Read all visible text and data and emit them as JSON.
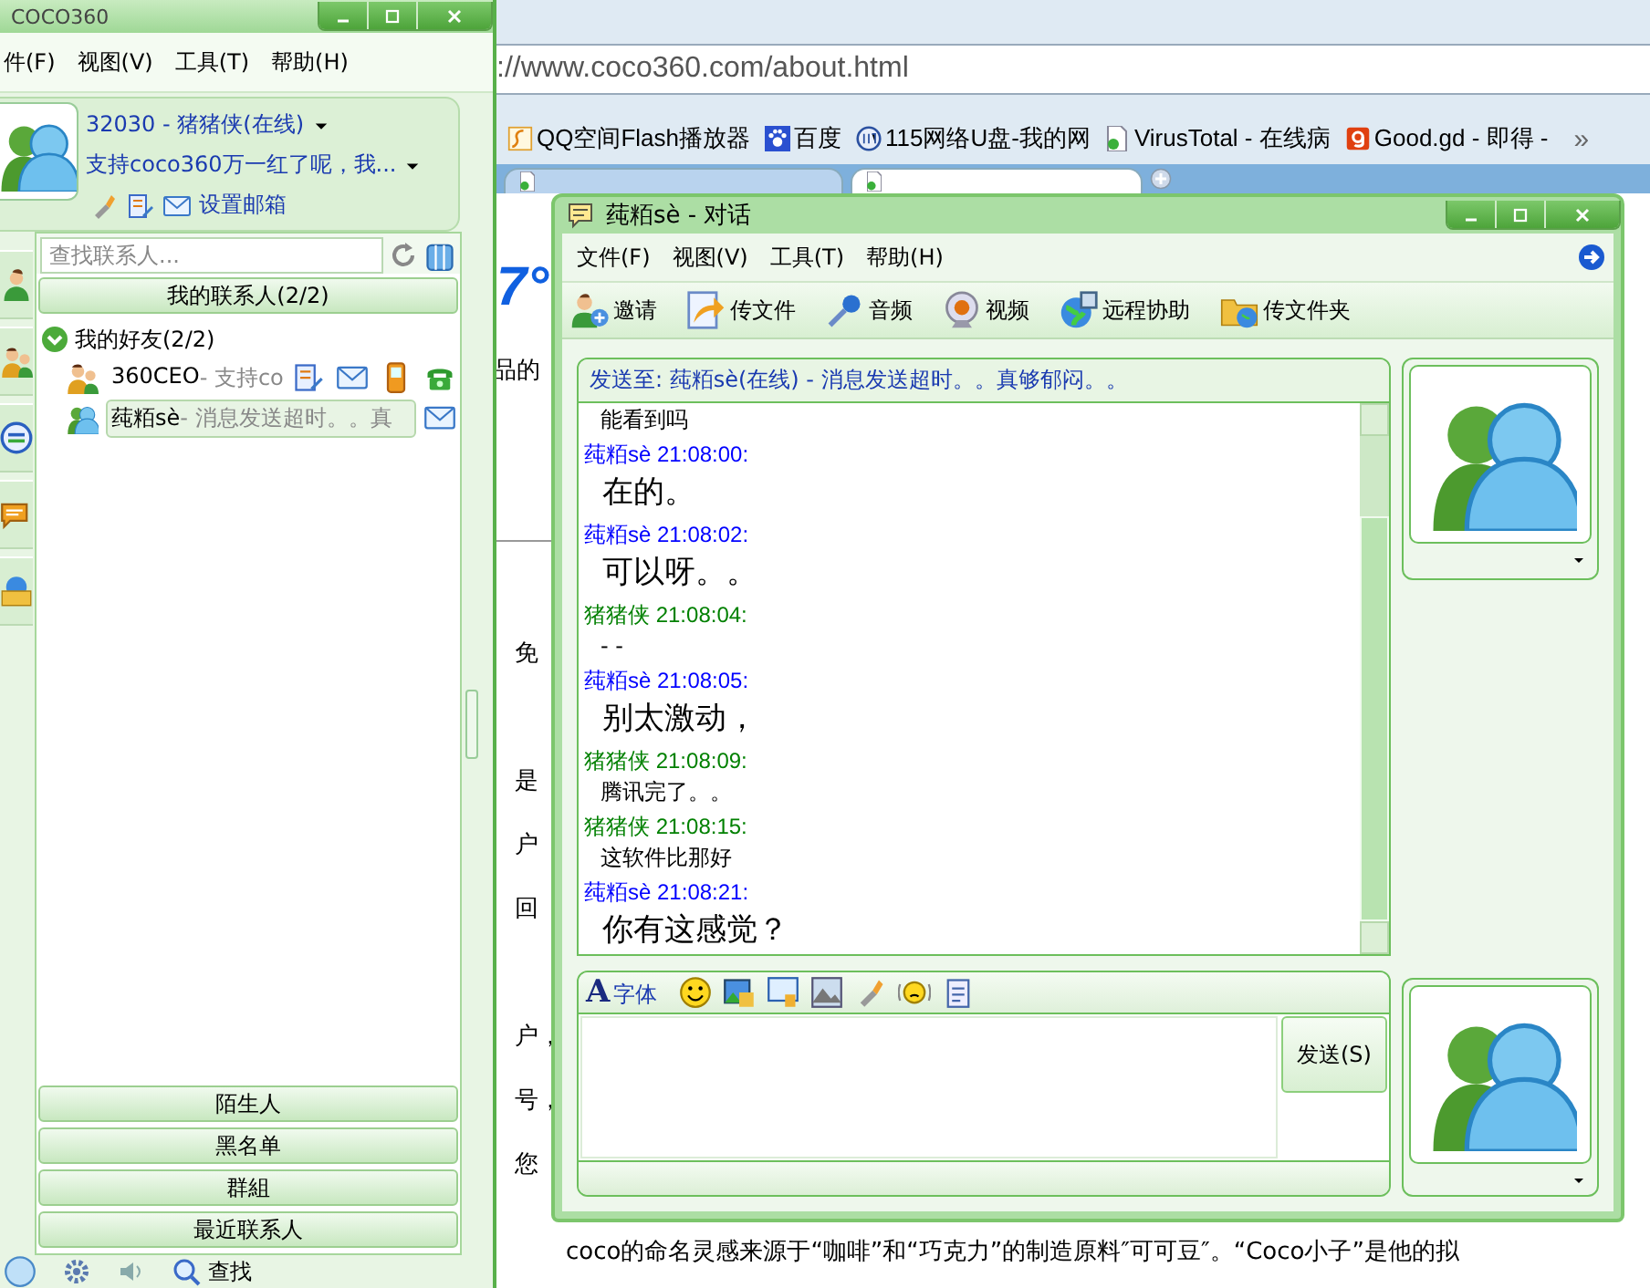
{
  "browser": {
    "address": "://www.coco360.com/about.html",
    "bookmarks": [
      {
        "label": "QQ空间Flash播放器",
        "kind": "flash"
      },
      {
        "label": "百度",
        "kind": "paw"
      },
      {
        "label": "115网络U盘-我的网",
        "kind": "disk"
      },
      {
        "label": "VirusTotal - 在线病",
        "kind": "page"
      },
      {
        "label": "Good.gd - 即得 -",
        "kind": "good"
      }
    ],
    "more": "»",
    "tabs": [
      {
        "selected": false
      },
      {
        "selected": true
      }
    ],
    "page": {
      "heading": "7°",
      "fragment": "品的",
      "lines": [
        "免",
        "是",
        "户",
        "回",
        "户，",
        "号，",
        "您"
      ],
      "footer": "coco的命名灵感来源于“咖啡”和“巧克力”的制造原料″可可豆″。“Coco小子”是他的拟"
    }
  },
  "contact_window": {
    "title": "COCO360",
    "menu": [
      "件(F)",
      "视图(V)",
      "工具(T)",
      "帮助(H)"
    ],
    "profile": {
      "status": "32030 - 猪猪侠(在线)",
      "signature": "支持coco360万一红了呢，我...",
      "mail_link": "设置邮箱"
    },
    "search": {
      "placeholder": "查找联系人..."
    },
    "contacts_header": "我的联系人(2/2)",
    "groups": [
      {
        "name": "我的好友(2/2)",
        "expanded": true,
        "children": [
          {
            "name": "360CEO",
            "note": " - 支持co",
            "selected": false,
            "actions": [
              {
                "kind": "edit"
              },
              {
                "kind": "mail"
              },
              {
                "kind": "mobile"
              },
              {
                "kind": "phone"
              }
            ]
          },
          {
            "name": "莼粨sè",
            "note": " - 消息发送超时。。真",
            "selected": true,
            "actions": [
              {
                "kind": "mail"
              }
            ]
          }
        ]
      }
    ],
    "bottom_groups": [
      "陌生人",
      "黑名单",
      "群組",
      "最近联系人"
    ],
    "bottom_bar": {
      "search_label": "查找"
    }
  },
  "chat_window": {
    "title": "莼粨sè - 对话",
    "menu": [
      "文件(F)",
      "视图(V)",
      "工具(T)",
      "帮助(H)"
    ],
    "toolbar": [
      {
        "label": "邀请",
        "kind": "invite"
      },
      {
        "label": "传文件",
        "kind": "file"
      },
      {
        "label": "音频",
        "kind": "mic"
      },
      {
        "label": "视频",
        "kind": "webcam"
      },
      {
        "label": "远程协助",
        "kind": "remote"
      },
      {
        "label": "传文件夹",
        "kind": "folder"
      }
    ],
    "send_to": "发送至: 莼粨sè(在线) - 消息发送超时。。真够郁闷。。",
    "messages": [
      {
        "text": "能看到吗",
        "large": false
      },
      {
        "header": "莼粨sè 21:08:00:",
        "color": "#0000ff",
        "text": "在的。",
        "large": true
      },
      {
        "header": "莼粨sè 21:08:02:",
        "color": "#0000ff",
        "text": "可以呀。。",
        "large": true
      },
      {
        "header": "猪猪侠 21:08:04:",
        "color": "#008000",
        "text": "- -",
        "large": false
      },
      {
        "header": "莼粨sè 21:08:05:",
        "color": "#0000ff",
        "text": "别太激动，",
        "large": true
      },
      {
        "header": "猪猪侠 21:08:09:",
        "color": "#008000",
        "text": "腾讯完了。。",
        "large": false
      },
      {
        "header": "猪猪侠 21:08:15:",
        "color": "#008000",
        "text": "这软件比那好",
        "large": false
      },
      {
        "header": "莼粨sè 21:08:21:",
        "color": "#0000ff",
        "text": "你有这感觉？",
        "large": true
      }
    ],
    "input_toolbar": {
      "font_glyph": "A",
      "font_label": "字体",
      "tools": [
        {
          "kind": "smiley"
        },
        {
          "kind": "image"
        },
        {
          "kind": "screen"
        },
        {
          "kind": "picture"
        },
        {
          "kind": "torch"
        },
        {
          "kind": "shake"
        },
        {
          "kind": "note"
        }
      ]
    },
    "send_button": "发送(S)"
  }
}
